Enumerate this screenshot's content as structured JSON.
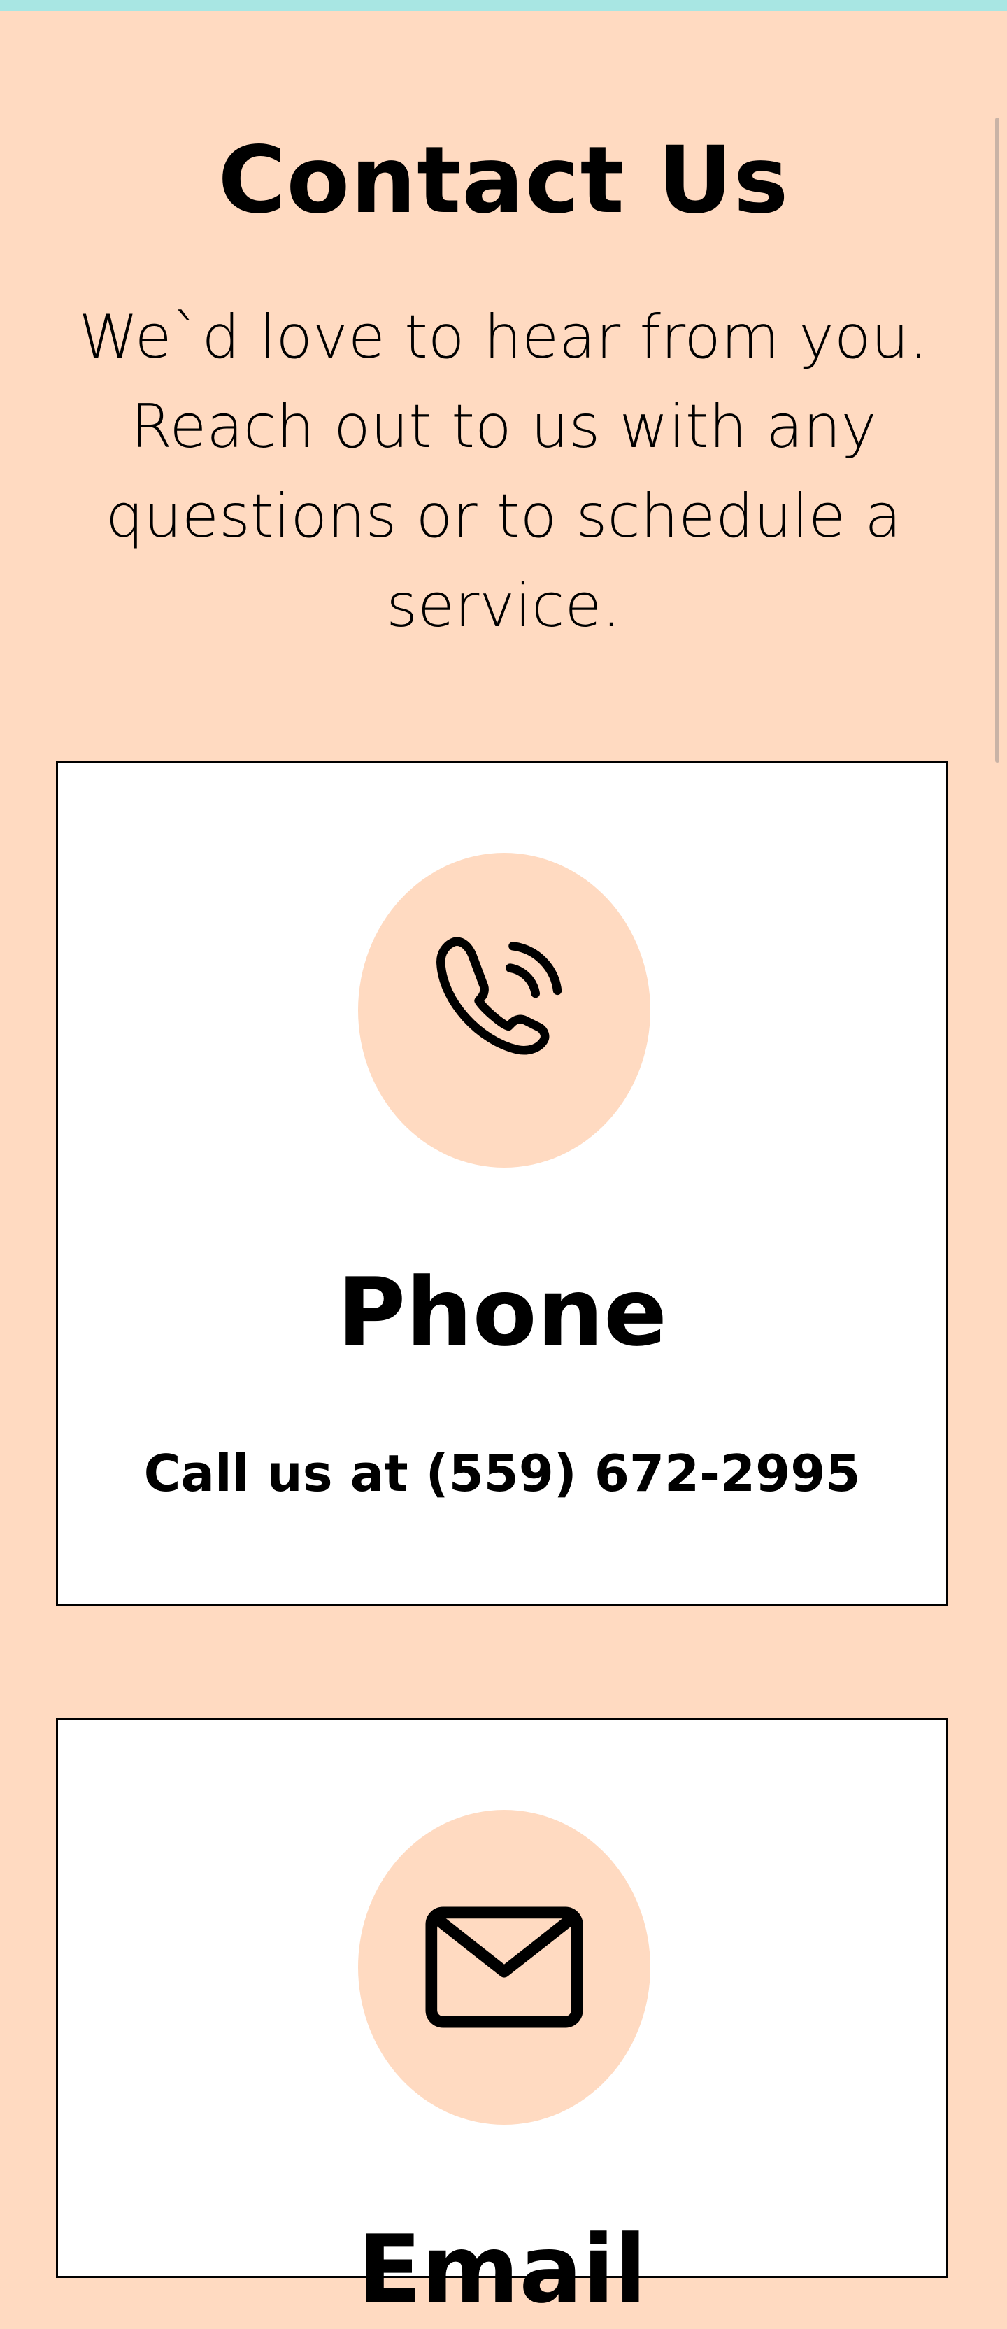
{
  "page": {
    "title": "Contact Us",
    "intro": "We`d love to hear from you. Reach out to us with any questions or to schedule a service."
  },
  "cards": [
    {
      "icon": "phone-icon",
      "heading": "Phone",
      "text": "Call us at (559) 672-2995"
    },
    {
      "icon": "mail-icon",
      "heading": "Email",
      "text": ""
    }
  ],
  "colors": {
    "background": "#FFDAC1",
    "top_bar": "#A8E6E3",
    "card_background": "#FFFFFF",
    "icon_circle": "#FFDAC1",
    "text": "#000000"
  }
}
